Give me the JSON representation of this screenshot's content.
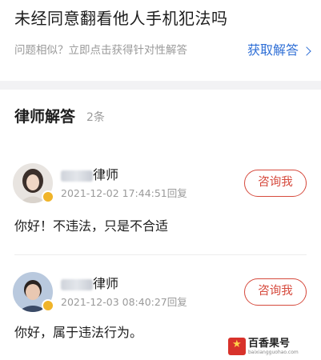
{
  "question": {
    "title": "未经同意翻看他人手机犯法吗",
    "hint": "问题相似？立即点击获得针对性解答",
    "cta_label": "获取解答"
  },
  "section": {
    "title": "律师解答",
    "count": "2条"
  },
  "answers": [
    {
      "lawyer_title": "律师",
      "time": "2021-12-02 17:44:51回复",
      "button_label": "咨询我",
      "text": "你好！不违法，只是不合适"
    },
    {
      "lawyer_title": "律师",
      "time": "2021-12-03 08:40:27回复",
      "button_label": "咨询我",
      "text": "你好，属于违法行为。"
    }
  ],
  "watermark": {
    "main": "百香果号",
    "sub": "baixiangguohao.com"
  },
  "colors": {
    "accent_blue": "#2f6fd6",
    "consult_red": "#d64a3d",
    "badge_gold": "#f0b429"
  }
}
